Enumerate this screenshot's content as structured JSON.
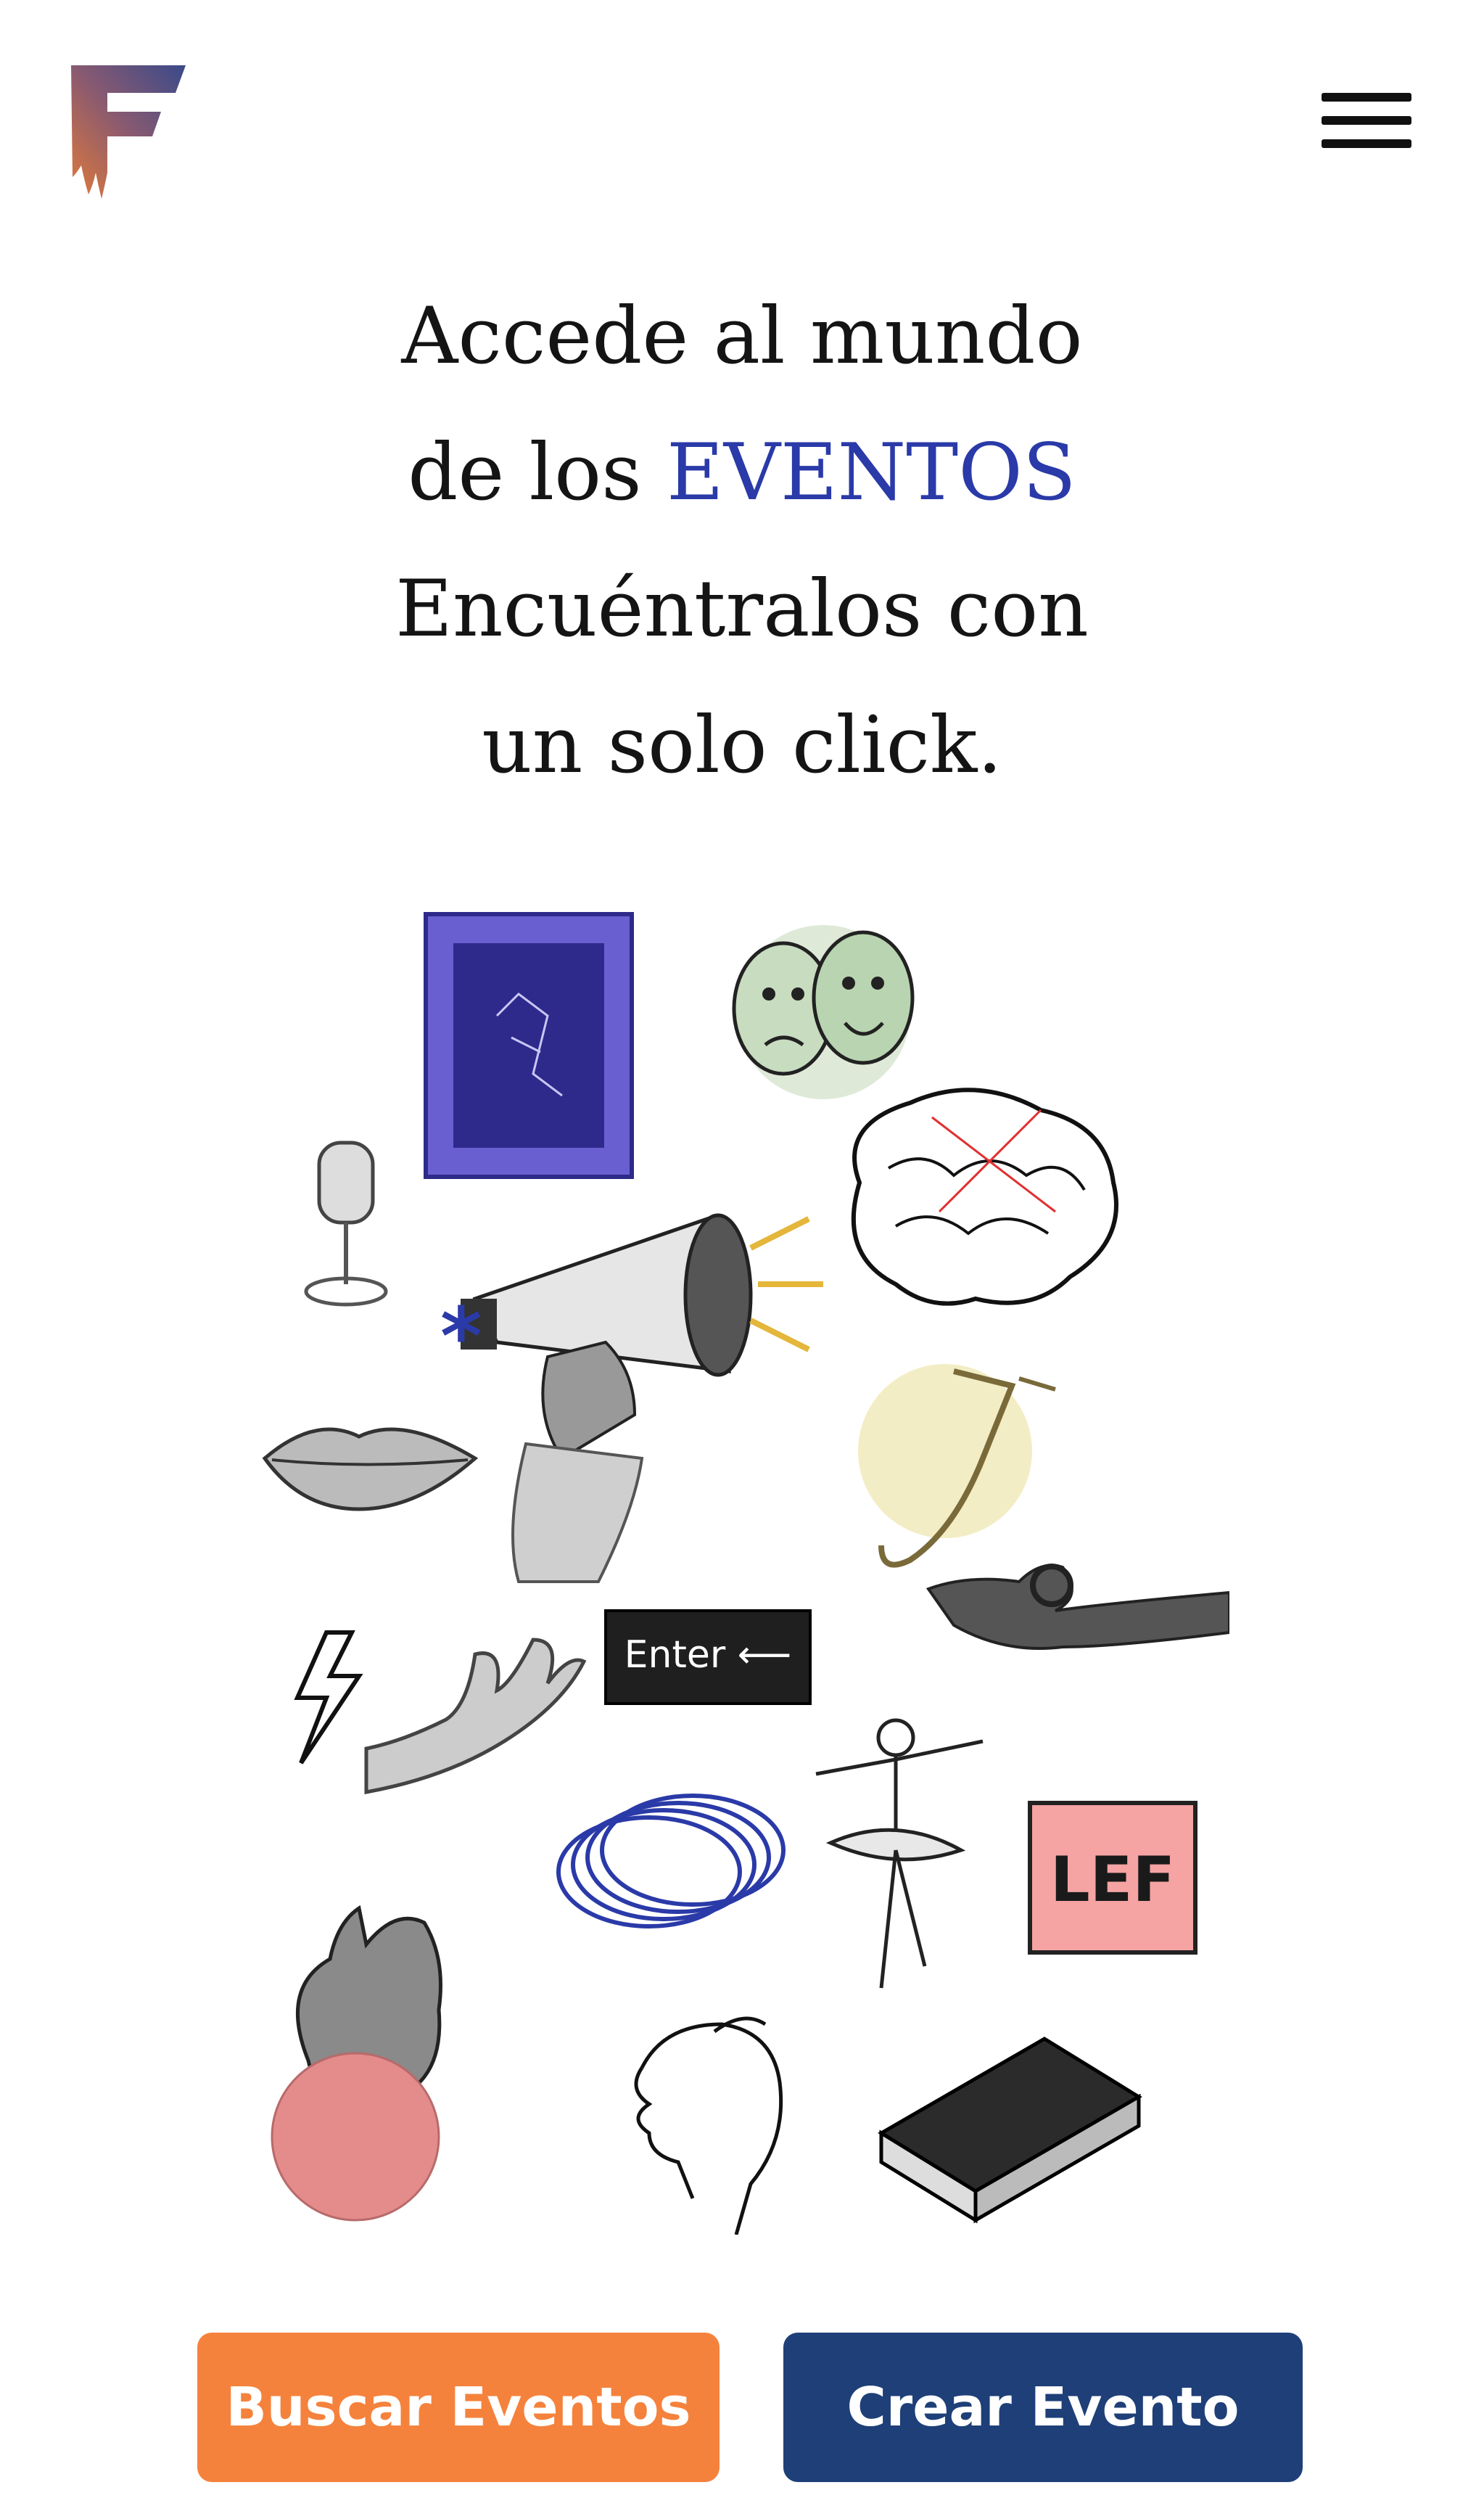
{
  "header": {
    "logo_letter": "F",
    "menu_icon": "hamburger-menu-icon"
  },
  "hero": {
    "line1": "Accede al mundo",
    "line2_prefix": "de los",
    "line2_accent": "EVENTOS",
    "line3": "Encuéntralos con",
    "line4": "un solo click.",
    "accent_color": "#2a3aa8"
  },
  "collage": {
    "enter_key_label": "Enter ⟵",
    "badge_text": "LEF"
  },
  "actions": {
    "search_label": "Buscar Eventos",
    "create_label": "Crear Evento",
    "search_color": "#f5823c",
    "create_color": "#1e3f78"
  }
}
